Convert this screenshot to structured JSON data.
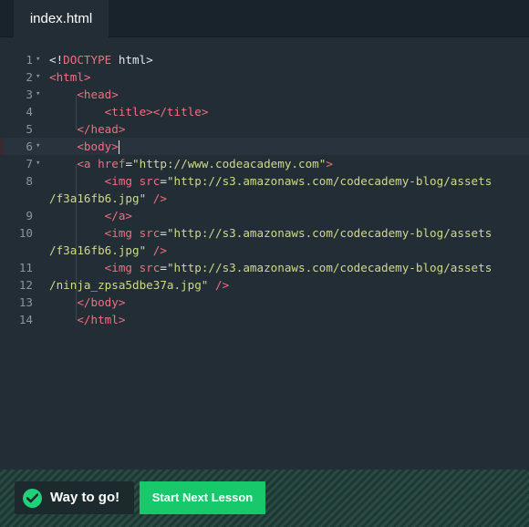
{
  "tab": {
    "filename": "index.html"
  },
  "editor": {
    "lines": [
      {
        "n": "1",
        "fold": true,
        "tokens": [
          {
            "c": "plain",
            "t": "<!"
          },
          {
            "c": "tag",
            "t": "DOCTYPE"
          },
          {
            "c": "plain",
            "t": " html>"
          }
        ]
      },
      {
        "n": "2",
        "fold": true,
        "tokens": [
          {
            "c": "tag",
            "t": "<html>"
          }
        ]
      },
      {
        "n": "3",
        "fold": true,
        "tokens": [
          {
            "c": "plain",
            "t": "    "
          },
          {
            "c": "tag",
            "t": "<head>"
          }
        ]
      },
      {
        "n": "4",
        "fold": false,
        "tokens": [
          {
            "c": "plain",
            "t": "        "
          },
          {
            "c": "tag",
            "t": "<title></title>"
          }
        ]
      },
      {
        "n": "5",
        "fold": false,
        "tokens": [
          {
            "c": "plain",
            "t": "    "
          },
          {
            "c": "tag",
            "t": "</head>"
          }
        ]
      },
      {
        "n": "6",
        "fold": true,
        "active": true,
        "cursor": true,
        "tokens": [
          {
            "c": "plain",
            "t": "    "
          },
          {
            "c": "tag",
            "t": "<body>"
          }
        ]
      },
      {
        "n": "7",
        "fold": true,
        "tokens": [
          {
            "c": "plain",
            "t": "    "
          },
          {
            "c": "tag",
            "t": "<a "
          },
          {
            "c": "attr",
            "t": "href"
          },
          {
            "c": "plain",
            "t": "="
          },
          {
            "c": "str",
            "t": "\"http://www.codeacademy.com\""
          },
          {
            "c": "tag",
            "t": ">"
          }
        ]
      },
      {
        "n": "8",
        "fold": false,
        "tokens": [
          {
            "c": "plain",
            "t": "        "
          },
          {
            "c": "tag",
            "t": "<img "
          },
          {
            "c": "attr",
            "t": "src"
          },
          {
            "c": "plain",
            "t": "="
          },
          {
            "c": "str",
            "t": "\"http://s3.amazonaws.com/codecademy-blog/assets"
          }
        ]
      },
      {
        "n": "",
        "fold": false,
        "tokens": [
          {
            "c": "str",
            "t": "/f3a16fb6.jpg\""
          },
          {
            "c": "plain",
            "t": " "
          },
          {
            "c": "tag",
            "t": "/>"
          }
        ]
      },
      {
        "n": "9",
        "fold": false,
        "tokens": [
          {
            "c": "plain",
            "t": "        "
          },
          {
            "c": "tag",
            "t": "</a>"
          }
        ]
      },
      {
        "n": "10",
        "fold": false,
        "tokens": [
          {
            "c": "plain",
            "t": "        "
          },
          {
            "c": "tag",
            "t": "<img "
          },
          {
            "c": "attr",
            "t": "src"
          },
          {
            "c": "plain",
            "t": "="
          },
          {
            "c": "str",
            "t": "\"http://s3.amazonaws.com/codecademy-blog/assets"
          }
        ]
      },
      {
        "n": "",
        "fold": false,
        "tokens": [
          {
            "c": "str",
            "t": "/f3a16fb6.jpg\""
          },
          {
            "c": "plain",
            "t": " "
          },
          {
            "c": "tag",
            "t": "/>"
          }
        ]
      },
      {
        "n": "11",
        "fold": false,
        "tokens": [
          {
            "c": "plain",
            "t": "        "
          },
          {
            "c": "tag",
            "t": "<img "
          },
          {
            "c": "attr",
            "t": "src"
          },
          {
            "c": "plain",
            "t": "="
          },
          {
            "c": "str",
            "t": "\"http://s3.amazonaws.com/codecademy-blog/assets"
          }
        ]
      },
      {
        "n": "12",
        "fold": false,
        "tokens": [
          {
            "c": "str",
            "t": "/ninja_zpsa5dbe37a.jpg\""
          },
          {
            "c": "plain",
            "t": " "
          },
          {
            "c": "tag",
            "t": "/>"
          }
        ]
      },
      {
        "n": "13",
        "fold": false,
        "tokens": [
          {
            "c": "plain",
            "t": "    "
          },
          {
            "c": "tag",
            "t": "</body>"
          }
        ]
      },
      {
        "n": "14",
        "fold": false,
        "tokens": [
          {
            "c": "plain",
            "t": "    "
          },
          {
            "c": "tag",
            "t": "</html>"
          }
        ]
      }
    ]
  },
  "footer": {
    "success_icon": "check-circle-icon",
    "success_text": "Way to go!",
    "next_button_label": "Start Next Lesson",
    "accent_color": "#18c96b"
  }
}
